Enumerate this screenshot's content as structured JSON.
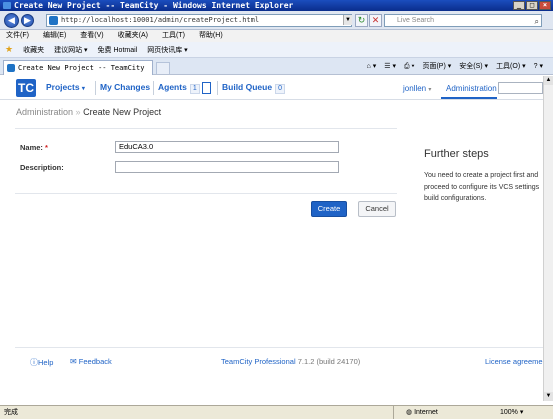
{
  "window": {
    "title": "Create New Project -- TeamCity - Windows Internet Explorer"
  },
  "browser": {
    "url": "http://localhost:10001/admin/createProject.html",
    "search_placeholder": "Live Search",
    "menu": [
      "文件(F)",
      "编辑(E)",
      "查看(V)",
      "收藏夹(A)",
      "工具(T)",
      "帮助(H)"
    ],
    "favorites_label": "收藏夹",
    "favorites": [
      "建议网站 ▾",
      "免费 Hotmail",
      "网页快讯库 ▾"
    ],
    "tab_title": "Create New Project -- TeamCity",
    "commands": [
      "页面(P) ▾",
      "安全(S) ▾",
      "工具(O) ▾"
    ]
  },
  "header": {
    "logo_text": "TC",
    "nav": {
      "projects": "Projects",
      "my_changes": "My Changes",
      "agents": "Agents",
      "agents_count": "1",
      "build_queue": "Build Queue",
      "queue_count": "0"
    },
    "user": "jonllen",
    "admin": "Administration"
  },
  "breadcrumb": {
    "parent": "Administration",
    "separator": "»",
    "current": "Create New Project"
  },
  "form": {
    "name_label": "Name:",
    "required_mark": "*",
    "name_value": "EduCA3.0",
    "description_label": "Description:",
    "description_value": "",
    "create_label": "Create",
    "cancel_label": "Cancel"
  },
  "side": {
    "title": "Further steps",
    "lines": [
      "You need to create a project first and",
      "proceed to configure its VCS settings",
      "build configurations."
    ]
  },
  "footer": {
    "help": "Help",
    "feedback": "Feedback",
    "product": "TeamCity Professional",
    "version": "7.1.2 (build 24170)",
    "license": "License agreeme"
  },
  "status": {
    "left": "完成",
    "zone": "Internet",
    "zoom": "100%"
  }
}
